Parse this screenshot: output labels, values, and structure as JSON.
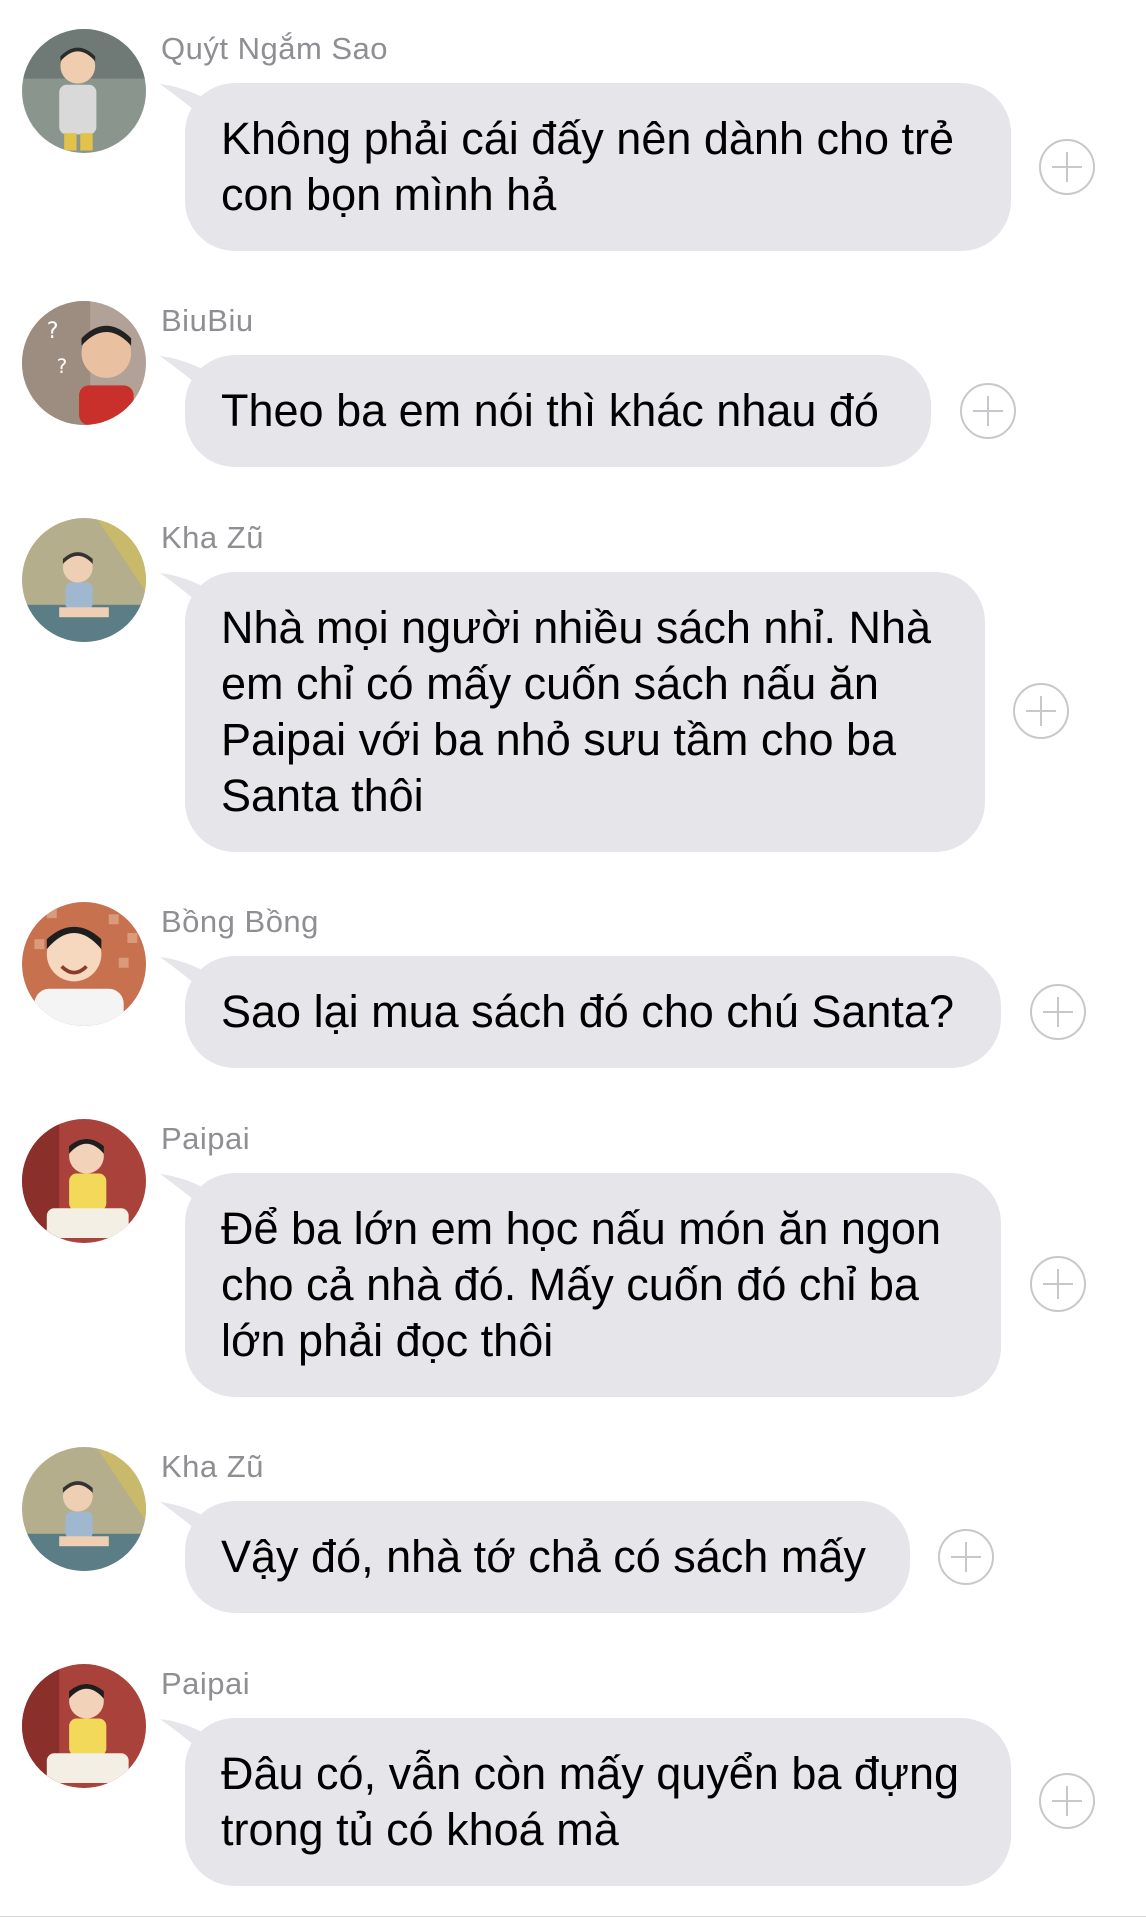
{
  "messages": [
    {
      "sender": "Quýt Ngắm Sao",
      "text": "Không phải cái đấy nên dành cho trẻ\ncon bọn mình hả",
      "avatar_icon": "child-avatar-icon",
      "avatar_color": "#7d8c80"
    },
    {
      "sender": "BiuBiu",
      "text": "Theo ba em nói thì khác nhau đó",
      "avatar_icon": "child-avatar-icon",
      "avatar_color": "#a89386"
    },
    {
      "sender": "Kha Zũ",
      "text": "Nhà mọi người nhiều sách nhỉ. Nhà\nem chỉ có mấy cuốn sách nấu ăn\nPaipai với ba nhỏ sưu tầm cho ba\nSanta thôi",
      "avatar_icon": "child-avatar-icon",
      "avatar_color": "#a8a27e"
    },
    {
      "sender": "Bồng Bồng",
      "text": "Sao lại mua sách đó cho chú Santa?",
      "avatar_icon": "child-avatar-icon",
      "avatar_color": "#b5694a"
    },
    {
      "sender": "Paipai",
      "text": "Để ba lớn em học nấu món ăn ngon\ncho cả nhà đó. Mấy cuốn đó chỉ ba\nlớn phải đọc thôi",
      "avatar_icon": "child-avatar-icon",
      "avatar_color": "#b04b3d"
    },
    {
      "sender": "Kha Zũ",
      "text": "Vậy đó, nhà tớ chả có sách mấy",
      "avatar_icon": "child-avatar-icon",
      "avatar_color": "#a8a27e"
    },
    {
      "sender": "Paipai",
      "text": "Đâu có, vẫn còn mấy quyển ba đựng\ntrong tủ có khoá mà",
      "avatar_icon": "child-avatar-icon",
      "avatar_color": "#b04b3d"
    }
  ],
  "add_icon": "plus-circle-icon",
  "colors": {
    "bubble": "#e5e5ea",
    "sender_text": "#8e8e93",
    "add_button": "#c7c7cc"
  }
}
